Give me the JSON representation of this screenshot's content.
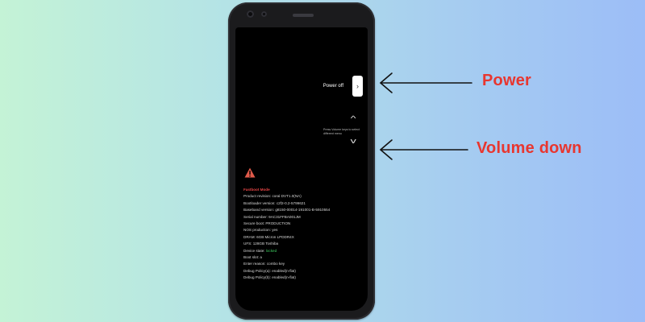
{
  "colors": {
    "background_left": "#c4f3d6",
    "background_right": "#9cbdf7",
    "callout": "#e8362f",
    "fastboot_title": "#e54545",
    "status_green": "#3fcf62",
    "warning_icon": "#e05a4a"
  },
  "phone": {
    "power_menu": {
      "label": "Power off",
      "button_icon": "chevron-right-icon",
      "button_glyph": "›"
    },
    "volume_hint": {
      "up_icon": "chevron-up-icon",
      "up_glyph": "^",
      "down_icon": "chevron-down-icon",
      "down_glyph": "v",
      "text": "Press Volume keys to select different menu"
    },
    "fastboot": {
      "icon": "warning-icon",
      "title": "Fastboot Mode",
      "lines": [
        {
          "text": "Product revision: coral DVT1.0(NA)"
        },
        {
          "text": "Bootloader version: c2f2-0.2-5799621"
        },
        {
          "text": "Baseband version: g8150-00014-191001-B-5910554"
        },
        {
          "text": "Serial number: 9AC31FFBA001JM"
        },
        {
          "text": "Secure boot: PRODUCTION"
        },
        {
          "text": "NOS production: yes"
        },
        {
          "text": "DRAM: 6GB Micron LPDDR4X"
        },
        {
          "text": "UFS: 128GB Toshiba"
        },
        {
          "text": "Device state: ",
          "value": "locked"
        },
        {
          "text": "Boot slot: a"
        },
        {
          "text": "Enter reason: combo key"
        },
        {
          "text": "Debug Policy(a): enabled(n-flat)"
        },
        {
          "text": "Debug Policy(b): enabled(n-flat)"
        }
      ]
    }
  },
  "annotations": {
    "power_label": "Power",
    "volume_down_label": "Volume down"
  }
}
